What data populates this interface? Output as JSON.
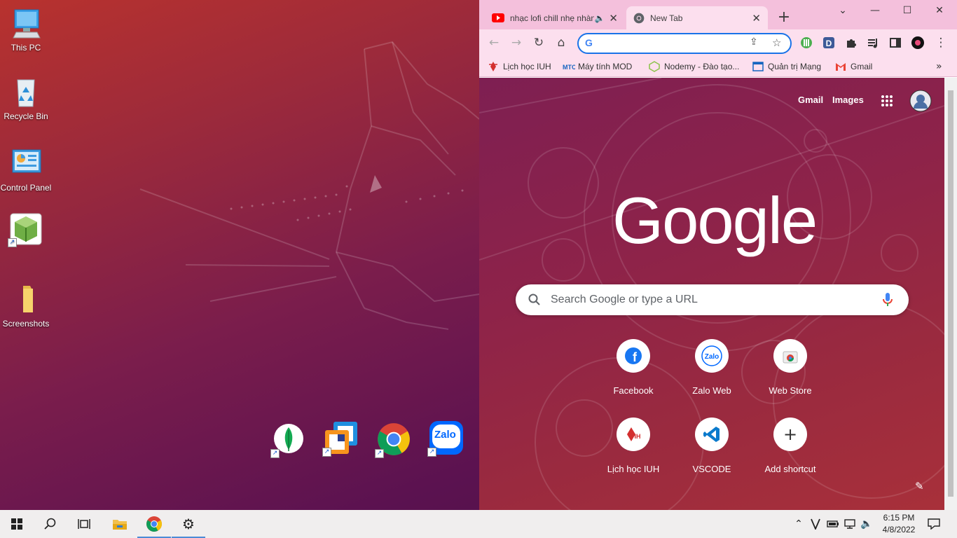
{
  "desktop": {
    "icons": [
      {
        "label": "This PC"
      },
      {
        "label": "Recycle Bin"
      },
      {
        "label": "Control Panel"
      },
      {
        "label": ""
      },
      {
        "label": "Screenshots"
      }
    ],
    "dock": [
      {
        "name": "mongodb-compass",
        "icon": "mongodb-leaf-icon"
      },
      {
        "name": "vmware",
        "icon": "vmware-icon"
      },
      {
        "name": "chrome",
        "icon": "chrome-icon"
      },
      {
        "name": "zalo",
        "icon": "zalo-icon",
        "text": "Zalo"
      }
    ]
  },
  "chrome": {
    "tabs": [
      {
        "title": "nhạc lofi chill nhẹ nhàng",
        "audio": true,
        "active": false
      },
      {
        "title": "New Tab",
        "active": true
      }
    ],
    "new_tab_symbol": "+",
    "omnibox": {
      "value": "",
      "placeholder": ""
    },
    "bookmarks": [
      {
        "label": "Lịch học IUH"
      },
      {
        "label": "Máy tính MOD"
      },
      {
        "label": "Nodemy - Đào tạo..."
      },
      {
        "label": "Quản trị Mạng"
      },
      {
        "label": "Gmail"
      }
    ],
    "ntp": {
      "top_links": [
        "Gmail",
        "Images"
      ],
      "logo": "Google",
      "search_placeholder": "Search Google or type a URL",
      "shortcuts": [
        {
          "label": "Facebook"
        },
        {
          "label": "Zalo Web"
        },
        {
          "label": "Web Store"
        },
        {
          "label": "Lịch học IUH"
        },
        {
          "label": "VSCODE"
        },
        {
          "label": "Add shortcut"
        }
      ]
    }
  },
  "taskbar": {
    "time": "6:15 PM",
    "date": "4/8/2022"
  },
  "colors": {
    "tabstrip": "#f4c0dc",
    "toolbar": "#fcdfee",
    "accent": "#1a73e8",
    "taskbar": "#f0eeee"
  }
}
